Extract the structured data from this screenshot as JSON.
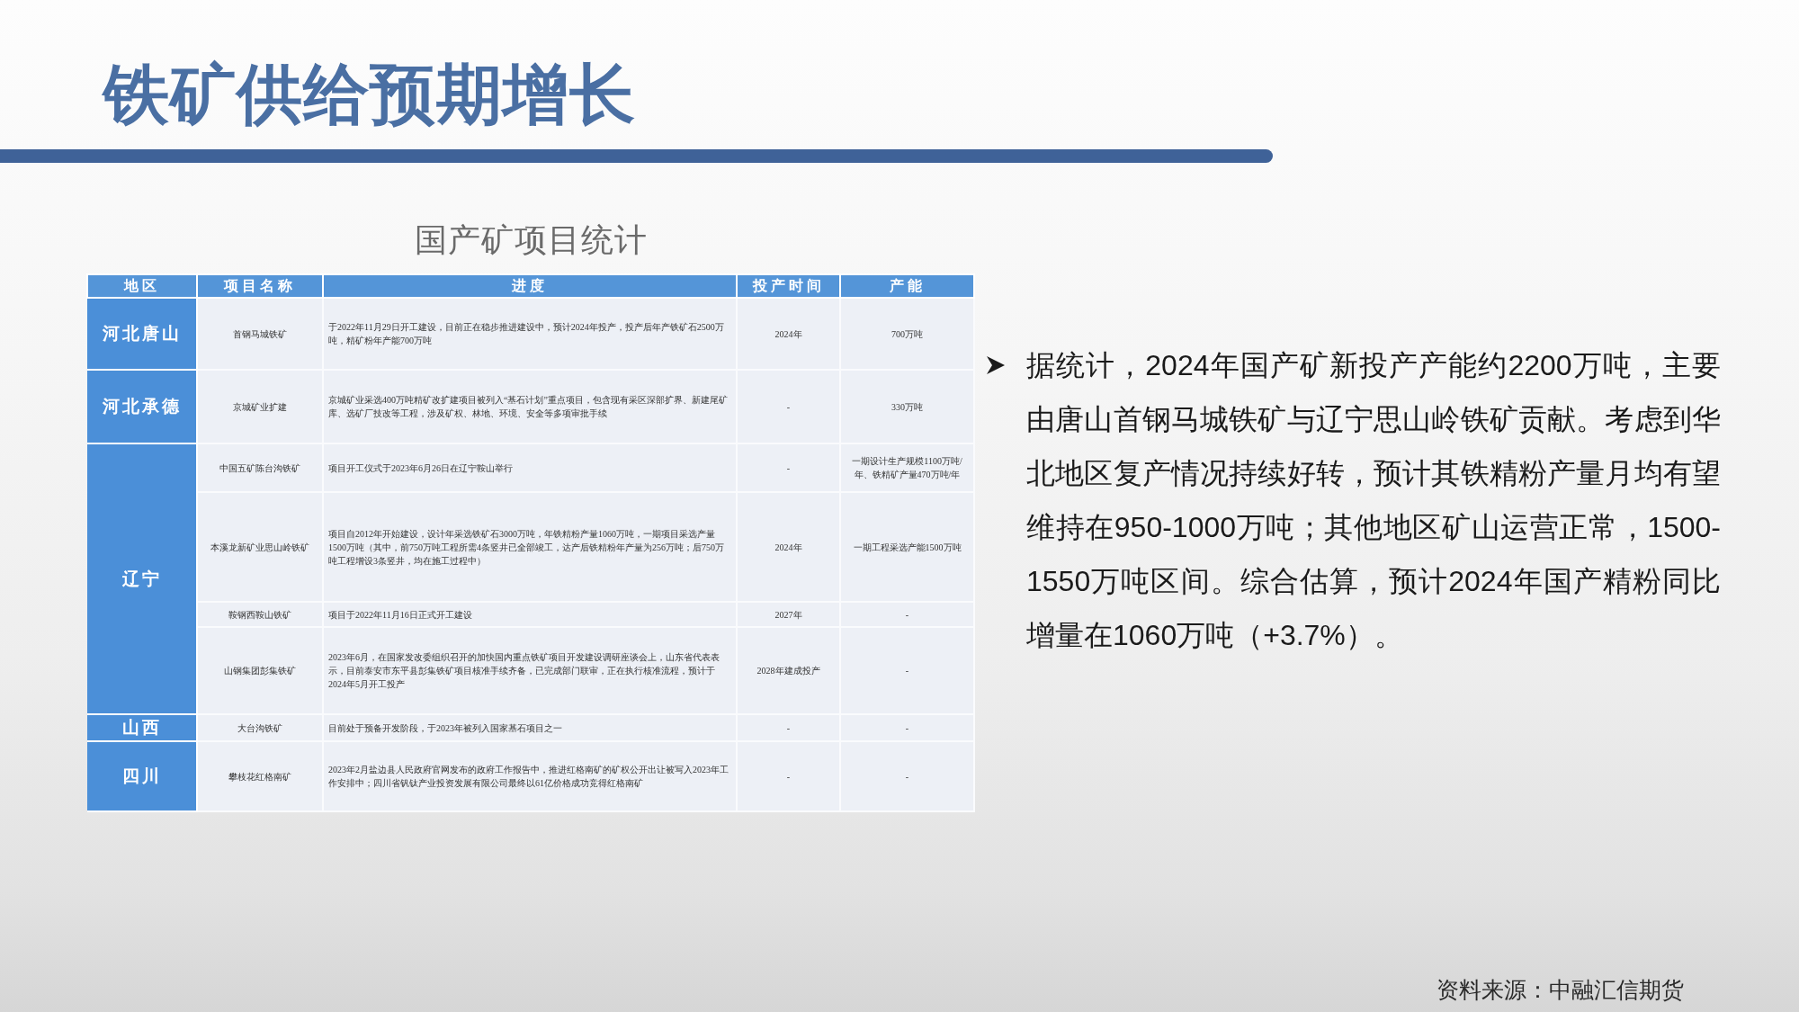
{
  "title": "铁矿供给预期增长",
  "table": {
    "caption": "国产矿项目统计",
    "columns": [
      "地区",
      "项目名称",
      "进度",
      "投产时间",
      "产能"
    ],
    "groups": [
      {
        "region": "河北唐山",
        "rows": [
          {
            "project": "首钢马城铁矿",
            "progress": "于2022年11月29日开工建设，目前正在稳步推进建设中，预计2024年投产，投产后年产铁矿石2500万吨，精矿粉年产能700万吨",
            "start": "2024年",
            "capacity": "700万吨"
          }
        ]
      },
      {
        "region": "河北承德",
        "rows": [
          {
            "project": "京城矿业扩建",
            "progress": "京城矿业采选400万吨精矿改扩建项目被列入“基石计划”重点项目，包含现有采区深部扩界、新建尾矿库、选矿厂技改等工程，涉及矿权、林地、环境、安全等多项审批手续",
            "start": "-",
            "capacity": "330万吨"
          }
        ]
      },
      {
        "region": "辽宁",
        "rows": [
          {
            "project": "中国五矿陈台沟铁矿",
            "progress": "项目开工仪式于2023年6月26日在辽宁鞍山举行",
            "start": "-",
            "capacity": "一期设计生产规模1100万吨/年、铁精矿产量470万吨/年"
          },
          {
            "project": "本溪龙新矿业思山岭铁矿",
            "progress": "项目自2012年开始建设，设计年采选铁矿石3000万吨，年铁精粉产量1060万吨，一期项目采选产量1500万吨（其中，前750万吨工程所需4条竖井已全部竣工，达产后铁精粉年产量为256万吨；后750万吨工程增设3条竖井，均在施工过程中）",
            "start": "2024年",
            "capacity": "一期工程采选产能1500万吨"
          },
          {
            "project": "鞍钢西鞍山铁矿",
            "progress": "项目于2022年11月16日正式开工建设",
            "start": "2027年",
            "capacity": "-"
          },
          {
            "project": "山钢集团彭集铁矿",
            "progress": "2023年6月，在国家发改委组织召开的加快国内重点铁矿项目开发建设调研座谈会上，山东省代表表示，目前泰安市东平县彭集铁矿项目核准手续齐备，已完成部门联审，正在执行核准流程，预计于2024年5月开工投产",
            "start": "2028年建成投产",
            "capacity": "-"
          }
        ]
      },
      {
        "region": "山西",
        "rows": [
          {
            "project": "大台沟铁矿",
            "progress": "目前处于预备开发阶段，于2023年被列入国家基石项目之一",
            "start": "-",
            "capacity": "-"
          }
        ]
      },
      {
        "region": "四川",
        "rows": [
          {
            "project": "攀枝花红格南矿",
            "progress": "2023年2月盐边县人民政府官网发布的政府工作报告中，推进红格南矿的矿权公开出让被写入2023年工作安排中；四川省钒钛产业投资发展有限公司最终以61亿价格成功竞得红格南矿",
            "start": "-",
            "capacity": "-"
          }
        ]
      }
    ]
  },
  "bullets": [
    "据统计，2024年国产矿新投产产能约2200万吨，主要由唐山首钢马城铁矿与辽宁思山岭铁矿贡献。考虑到华北地区复产情况持续好转，预计其铁精粉产量月均有望维持在950-1000万吨；其他地区矿山运营正常，1500-1550万吨区间。综合估算，预计2024年国产精粉同比增量在1060万吨（+3.7%）。"
  ],
  "source": "资料来源：中融汇信期货"
}
